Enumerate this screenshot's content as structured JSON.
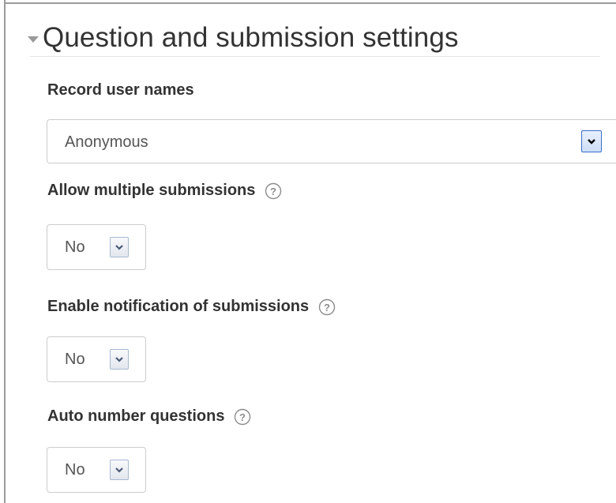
{
  "section": {
    "title": "Question and submission settings",
    "collapse_icon": "chevron-down-icon"
  },
  "fields": {
    "record_user_names": {
      "label": "Record user names",
      "value": "Anonymous"
    },
    "allow_multiple_submissions": {
      "label": "Allow multiple submissions",
      "value": "No",
      "help_icon": "help-icon"
    },
    "enable_notification": {
      "label": "Enable notification of submissions",
      "value": "No",
      "help_icon": "help-icon"
    },
    "auto_number_questions": {
      "label": "Auto number questions",
      "value": "No",
      "help_icon": "help-icon"
    }
  },
  "colors": {
    "text": "#333333",
    "select_border": "#cccccc",
    "frame_border": "#9a9a9a",
    "dropdown_accent": "#3a6fc7"
  }
}
